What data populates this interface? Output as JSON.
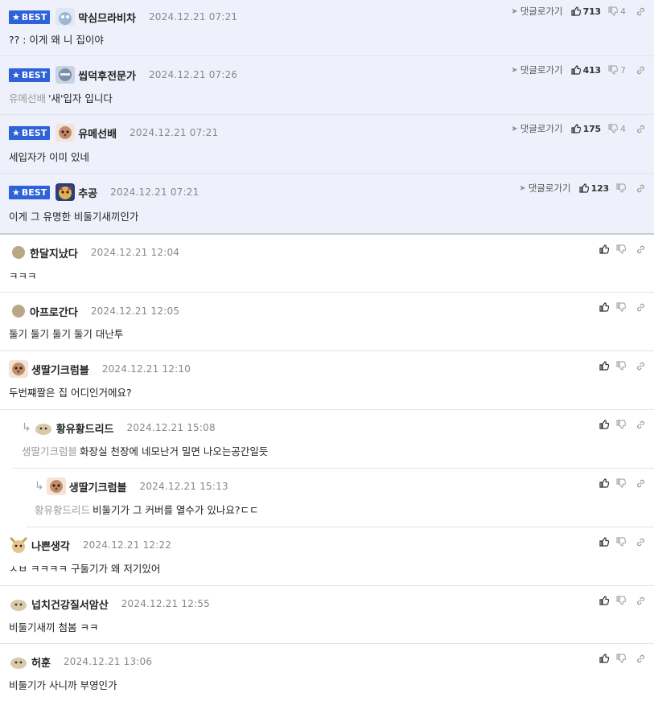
{
  "best_label": "BEST",
  "goto_label": "댓글로가기",
  "comments": [
    {
      "nick": "막심므라비차",
      "date": "2024.12.21 07:21",
      "text": "?? : 이게 왜 니 집이야",
      "mention": "",
      "up": "713",
      "down": "4"
    },
    {
      "nick": "씹덕후전문가",
      "date": "2024.12.21 07:26",
      "text": "'새'입자 입니다",
      "mention": "유메선배",
      "up": "413",
      "down": "7"
    },
    {
      "nick": "유메선배",
      "date": "2024.12.21 07:21",
      "text": "세입자가 이미 있네",
      "mention": "",
      "up": "175",
      "down": "4"
    },
    {
      "nick": "추공",
      "date": "2024.12.21 07:21",
      "text": "이게 그 유명한 비둘기새끼인가",
      "mention": "",
      "up": "123",
      "down": ""
    },
    {
      "nick": "한달지났다",
      "date": "2024.12.21 12:04",
      "text": "ㅋㅋㅋ",
      "mention": ""
    },
    {
      "nick": "아프로간다",
      "date": "2024.12.21 12:05",
      "text": "둘기 둘기 둘기 둘기 대난투",
      "mention": ""
    },
    {
      "nick": "생딸기크럼블",
      "date": "2024.12.21 12:10",
      "text": "두번쨰짤은 집 어디인거에요?",
      "mention": ""
    },
    {
      "nick": "황유황드리드",
      "date": "2024.12.21 15:08",
      "text": "화장실 천장에 네모난거 밀면 나오는공간일듯",
      "mention": "생딸기크럼블"
    },
    {
      "nick": "생딸기크럼블",
      "date": "2024.12.21 15:13",
      "text": "비둘기가 그 커버를 열수가 있나요?ㄷㄷ",
      "mention": "황유황드리드"
    },
    {
      "nick": "나쁜생각",
      "date": "2024.12.21 12:22",
      "text": "ㅅㅂ ㅋㅋㅋㅋ 구둘기가 왜 저기있어",
      "mention": ""
    },
    {
      "nick": "넙치건강질서암산",
      "date": "2024.12.21 12:55",
      "text": "비둘기새끼 첨봄 ㅋㅋ",
      "mention": ""
    },
    {
      "nick": "허훈",
      "date": "2024.12.21 13:06",
      "text": "비둘기가 사니까 부영인가",
      "mention": ""
    }
  ]
}
